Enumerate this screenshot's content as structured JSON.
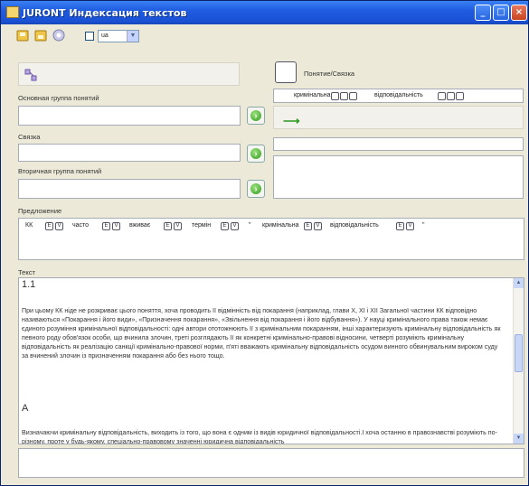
{
  "window": {
    "title": "JURONT Индексация текстов",
    "controls": [
      "minimize-button",
      "maximize-button",
      "close-button"
    ],
    "accent": "#1f5ce0"
  },
  "toolbar": {
    "icons": [
      "save-icon",
      "open-icon",
      "settings-icon"
    ],
    "checkbox_checked": false,
    "language": "ua"
  },
  "left": {
    "main_group_label": "Основная группа понятий",
    "main_group_value": "",
    "link_label": "Связка",
    "link_value": "",
    "secondary_group_label": "Вторичная группа понятий",
    "secondary_group_value": ""
  },
  "right": {
    "concept_label": "Понятие/Связка",
    "chips": [
      "кримінальна",
      "відповідальність"
    ]
  },
  "sentence": {
    "label": "Предложение",
    "words": [
      "КК",
      "часто",
      "вживає",
      "термін",
      "\"",
      "кримінальна",
      "відповідальність",
      "\""
    ]
  },
  "text": {
    "label": "Текст",
    "heading": "1.1",
    "paragraph1": "При цьому КК ніде не розкриває цього поняття, хоча проводить її відмінність від покарання (наприклад, глави X, XI і XII Загальної частини КК відповідно називаються «Покарання і його види», «Призначення покарання», «Звільнення від покарання і його відбування»). У науці кримінального права також немає єдиного розуміння кримінальної відповідальності: одні автори ототожнюють її з кримінальним покаранням, інші характеризують кримінальну відповідальність як певного роду обов'язок особи, що вчинила злочин, треті розглядають її як конкретні кримінально-правові відносини, четверті розуміють кримінальну відповідальність як реалізацію санкції кримінально-правової норми, п'яті вважають кримінальну відповідальність осудом винного обвинувальним вироком суду за вчинений злочин із призначенням покарання або без нього тощо.",
    "subheading": "А",
    "paragraph2": "Визначаючи кримінальну відповідальність, виходить із того, що вона є одним із видів юридичної відповідальності.І хоча останню в правознавстві розуміють по-різному, проте у будь-якому, спеціально-правовому значенні юридична відповідальність"
  }
}
